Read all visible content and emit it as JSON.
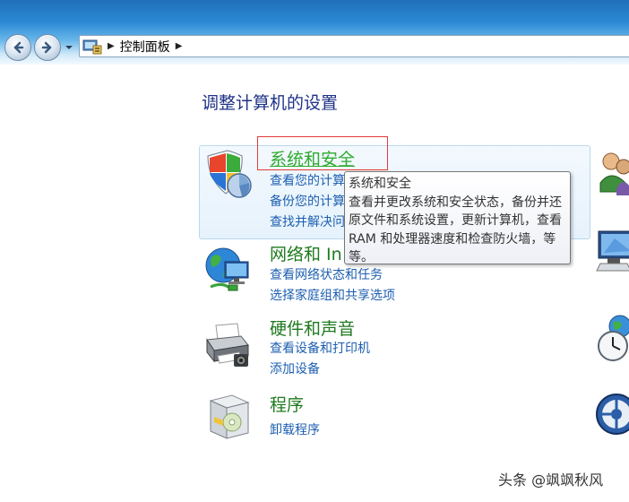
{
  "addressbar": {
    "path_label": "控制面板"
  },
  "page": {
    "title": "调整计算机的设置"
  },
  "categories": [
    {
      "title": "系统和安全",
      "links": [
        "查看您的计算",
        "备份您的计算",
        "查找并解决问"
      ]
    },
    {
      "title": "网络和 In",
      "links": [
        "查看网络状态和任务",
        "选择家庭组和共享选项"
      ]
    },
    {
      "title": "硬件和声音",
      "links": [
        "查看设备和打印机",
        "添加设备"
      ]
    },
    {
      "title": "程序",
      "links": [
        "卸载程序"
      ]
    }
  ],
  "tooltip": {
    "title": "系统和安全",
    "body": "查看并更改系统和安全状态，备份并还原文件和系统设置，更新计算机，查看 RAM 和处理器速度和检查防火墙，等等。"
  },
  "watermark": "头条 @飒飒秋风",
  "colors": {
    "link": "#1d5fb0",
    "category_title": "#1f7a1f",
    "category_title_hover": "#2eaa2e",
    "page_title": "#1e3287",
    "highlight_box": "#e23a3a"
  },
  "icons": {
    "back": "back-arrow-icon",
    "forward": "forward-arrow-icon",
    "address": "control-panel-icon",
    "system_security": "shield-icon",
    "network": "globe-network-icon",
    "hardware": "printer-icon",
    "programs": "programs-box-icon",
    "user_accounts": "users-icon",
    "appearance": "monitor-icon",
    "clock": "clock-globe-icon",
    "ease_of_access": "ease-of-access-icon"
  }
}
